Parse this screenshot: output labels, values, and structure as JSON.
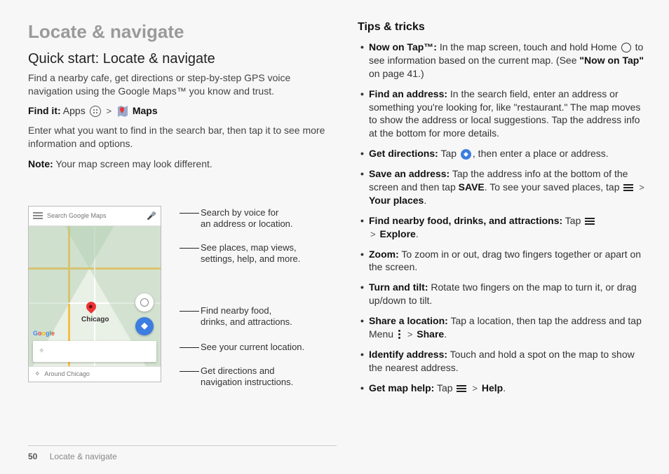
{
  "left": {
    "title": "Locate & navigate",
    "subtitle": "Quick start: Locate & navigate",
    "intro": "Find a nearby cafe, get directions or step-by-step GPS voice navigation using the Google Maps™ you know and trust.",
    "findit_label": "Find it:",
    "findit_apps": "Apps",
    "findit_maps": "Maps",
    "enter": "Enter what you want to find in the search bar, then tap it to see more information and options.",
    "note_label": "Note:",
    "note_text": "Your map screen may look different."
  },
  "phone": {
    "search_placeholder": "Search Google Maps",
    "city": "Chicago",
    "around": "Around Chicago",
    "google": [
      "G",
      "o",
      "o",
      "g",
      "l",
      "e"
    ],
    "callouts": {
      "voice1": "Search by voice for",
      "voice2": "an address or location.",
      "menu1": "See places, map views,",
      "menu2": "settings, help, and more.",
      "food1": "Find nearby food,",
      "food2": "drinks, and attractions.",
      "loc": "See your current location.",
      "dir1": "Get directions and",
      "dir2": "navigation instructions."
    }
  },
  "right": {
    "heading": "Tips & tricks",
    "tips": {
      "nowontap_b": "Now on Tap™:",
      "nowontap_1": "In the map screen, touch and hold Home",
      "nowontap_2": "to see information based on the current map. (See",
      "nowontap_q": "\"Now on Tap\"",
      "nowontap_3": "on page 41.)",
      "findaddr_b": "Find an address:",
      "findaddr_t": "In the search field, enter an address or something you're looking for, like \"restaurant.\" The map moves to show the address or local suggestions. Tap the address info at the bottom for more details.",
      "getdir_b": "Get directions:",
      "getdir_t": "Tap",
      "getdir_t2": ", then enter a place or address.",
      "save_b": "Save an address:",
      "save_t1": "Tap the address info at the bottom of the screen and then tap",
      "save_save": "SAVE",
      "save_t2": ". To see your saved places, tap",
      "save_yp": "Your places",
      "nearby_b": "Find nearby food, drinks, and attractions:",
      "nearby_t": "Tap",
      "nearby_ex": "Explore",
      "zoom_b": "Zoom:",
      "zoom_t": "To zoom in or out, drag two fingers together or apart on the screen.",
      "turn_b": "Turn and tilt:",
      "turn_t": "Rotate two fingers on the map to turn it, or drag up/down to tilt.",
      "share_b": "Share a location:",
      "share_t": "Tap a location, then tap the address and tap Menu",
      "share_s": "Share",
      "ident_b": "Identify address:",
      "ident_t": "Touch and hold a spot on the map to show the nearest address.",
      "help_b": "Get map help:",
      "help_t": "Tap",
      "help_h": "Help"
    }
  },
  "footer": {
    "page": "50",
    "section": "Locate & navigate"
  }
}
